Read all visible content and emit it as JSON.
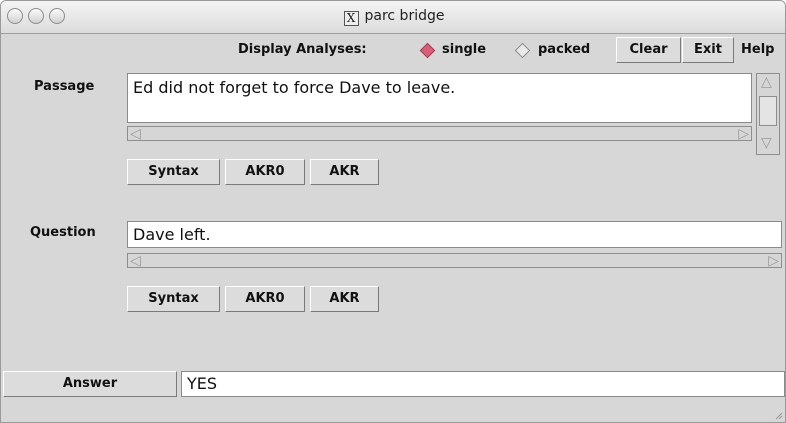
{
  "window": {
    "title": "parc bridge",
    "x_icon": "X"
  },
  "toolbar": {
    "display_label": "Display Analyses:",
    "single_label": "single",
    "packed_label": "packed",
    "selected": "single",
    "clear_label": "Clear",
    "exit_label": "Exit",
    "help_label": "Help"
  },
  "passage": {
    "label": "Passage",
    "text": "Ed did not forget to force Dave to leave.",
    "buttons": [
      "Syntax",
      "AKR0",
      "AKR"
    ]
  },
  "question": {
    "label": "Question",
    "text": "Dave left.",
    "buttons": [
      "Syntax",
      "AKR0",
      "AKR"
    ]
  },
  "answer": {
    "label": "Answer",
    "value": "YES"
  },
  "colors": {
    "radio_selected": "#d95f78",
    "background": "#d7d7d7"
  },
  "icons": {
    "traffic_lights": [
      "close-icon",
      "minimize-icon",
      "zoom-icon"
    ],
    "scroll_left": "arrow-left-icon",
    "scroll_right": "arrow-right-icon",
    "scroll_up": "arrow-up-icon",
    "scroll_down": "arrow-down-icon"
  }
}
